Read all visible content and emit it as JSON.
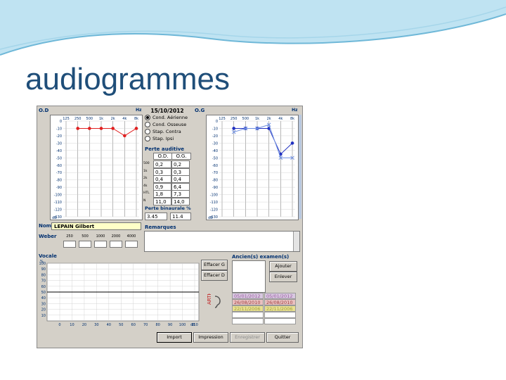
{
  "slide": {
    "title": "audiogrammes"
  },
  "app": {
    "right_ear_label": "O.D",
    "left_ear_label": "O.G",
    "hz_label": "Hz",
    "db_label": "dB",
    "freq_ticks": [
      "125",
      "250",
      "500",
      "1k",
      "2k",
      "4k",
      "8k"
    ],
    "db_ticks": [
      "0",
      "-10",
      "-20",
      "-30",
      "-40",
      "-50",
      "-60",
      "-70",
      "-80",
      "-90",
      "-100",
      "-110",
      "-120",
      "-130"
    ],
    "exam_date": "15/10/2012",
    "radios": [
      {
        "label": "Cond. Aérienne",
        "selected": true
      },
      {
        "label": "Cond. Osseuse",
        "selected": false
      },
      {
        "label": "Stap. Contra",
        "selected": false
      },
      {
        "label": "Stap. Ipsi",
        "selected": false
      }
    ],
    "perte_auditive": {
      "title": "Perte auditive",
      "col_od": "O.D.",
      "col_og": "O.G.",
      "rows": [
        {
          "freq": "500",
          "od": "0,2",
          "og": "0,2"
        },
        {
          "freq": "1k",
          "od": "0,3",
          "og": "0,3"
        },
        {
          "freq": "2k",
          "od": "0,4",
          "og": "0,4"
        },
        {
          "freq": "4k",
          "od": "0,9",
          "og": "6,4"
        },
        {
          "freq": "HTL",
          "od": "1,8",
          "og": "7,3"
        },
        {
          "freq": "N",
          "od": "11,0",
          "og": "14,0"
        }
      ]
    },
    "perte_binaurale": {
      "title": "Perte binaurale %",
      "od": "3.45",
      "og": "11.4"
    },
    "nom_label": "Nom",
    "nom_value": "LEPAIN Gilbert",
    "remarques_label": "Remarques",
    "weber_label": "Weber",
    "weber_freqs": [
      "250",
      "500",
      "1000",
      "2000",
      "4000"
    ],
    "vocale_label": "Vocale",
    "vocale_y_ticks": [
      "100",
      "90",
      "80",
      "70",
      "60",
      "50",
      "40",
      "30",
      "20",
      "10"
    ],
    "vocale_x_ticks": [
      "0",
      "10",
      "20",
      "30",
      "40",
      "50",
      "60",
      "70",
      "80",
      "90",
      "100",
      "110"
    ],
    "vocale_unit": "%",
    "vocale_db": "dB",
    "buttons": {
      "effacer_g": "Effacer G",
      "effacer_d": "Effacer D",
      "ajouter": "Ajouter",
      "enlever": "Enlever",
      "import": "Import",
      "impression": "Impression",
      "enregistrer": "Enregistrer",
      "quitter": "Quitter"
    },
    "ancien_label": "Ancien(s)  examen(s)",
    "history": [
      {
        "left": "05/01/2012",
        "right": "05/01/2012",
        "color": "#9a5aa0",
        "bg": "#d8c8e0"
      },
      {
        "left": "26/08/2010",
        "right": "26/08/2010",
        "color": "#a04040",
        "bg": "#e8c0c0"
      },
      {
        "left": "22/11/2006",
        "right": "22/11/2006",
        "color": "#a0a040",
        "bg": "#e8e090"
      }
    ],
    "colors": {
      "od": "#e02020",
      "og": "#2030c0",
      "og_light": "#7090e0",
      "od_light": "#e89ab0"
    }
  },
  "chart_data": [
    {
      "type": "line",
      "title": "O.D",
      "categories": [
        "125",
        "250",
        "500",
        "1k",
        "2k",
        "4k",
        "8k"
      ],
      "ylabel": "dB",
      "ylim": [
        0,
        -130
      ],
      "series": [
        {
          "values": [
            null,
            -10,
            -10,
            -10,
            -10,
            -20,
            -10
          ]
        }
      ]
    },
    {
      "type": "line",
      "title": "O.G",
      "categories": [
        "125",
        "250",
        "500",
        "1k",
        "2k",
        "4k",
        "8k"
      ],
      "ylabel": "dB",
      "ylim": [
        0,
        -130
      ],
      "series": [
        {
          "values": [
            null,
            -10,
            -10,
            -10,
            -10,
            -45,
            -30
          ]
        },
        {
          "values": [
            null,
            -15,
            -10,
            -10,
            -5,
            -50,
            -50
          ]
        }
      ]
    }
  ]
}
